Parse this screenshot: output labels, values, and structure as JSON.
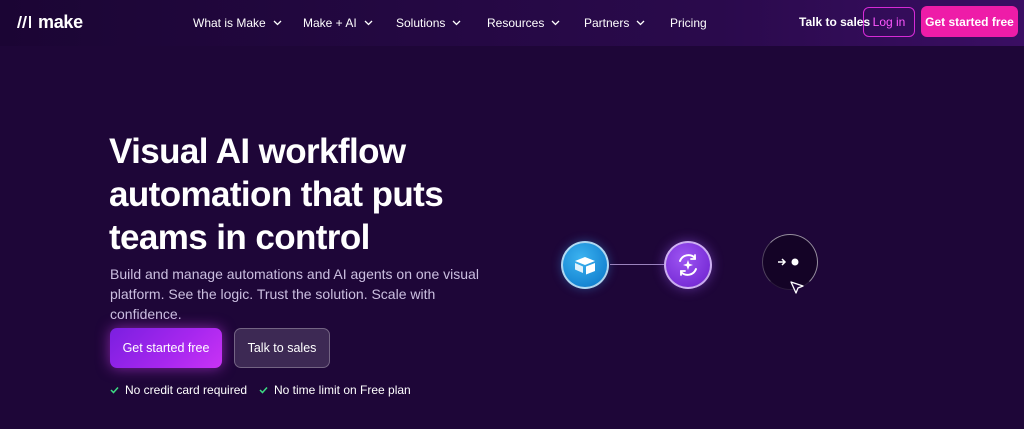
{
  "brand": {
    "name": "make"
  },
  "nav": {
    "items": [
      {
        "label": "What is Make",
        "has_dropdown": true
      },
      {
        "label": "Make + AI",
        "has_dropdown": true
      },
      {
        "label": "Solutions",
        "has_dropdown": true
      },
      {
        "label": "Resources",
        "has_dropdown": true
      },
      {
        "label": "Partners",
        "has_dropdown": true
      },
      {
        "label": "Pricing",
        "has_dropdown": false
      }
    ],
    "talk_to_sales": "Talk to sales",
    "login": "Log in",
    "get_started": "Get started free"
  },
  "hero": {
    "title_lines": [
      "Visual AI workflow",
      "automation that puts",
      "teams in control"
    ],
    "subtitle_lines": [
      "Build and manage automations and AI agents on one visual",
      "platform. See the logic. Trust the solution. Scale with confidence."
    ],
    "primary_cta": "Get started free",
    "secondary_cta": "Talk to sales",
    "perks": [
      "No credit card required",
      "No time limit on Free plan"
    ]
  },
  "illustration": {
    "nodes": [
      "airtable-icon",
      "ai-agent-icon",
      "next-step-icon"
    ]
  },
  "colors": {
    "background": "#1e0638",
    "accent_pink": "#ee1ca8",
    "login_border": "#d62bd6",
    "check_green": "#3ddc84"
  }
}
